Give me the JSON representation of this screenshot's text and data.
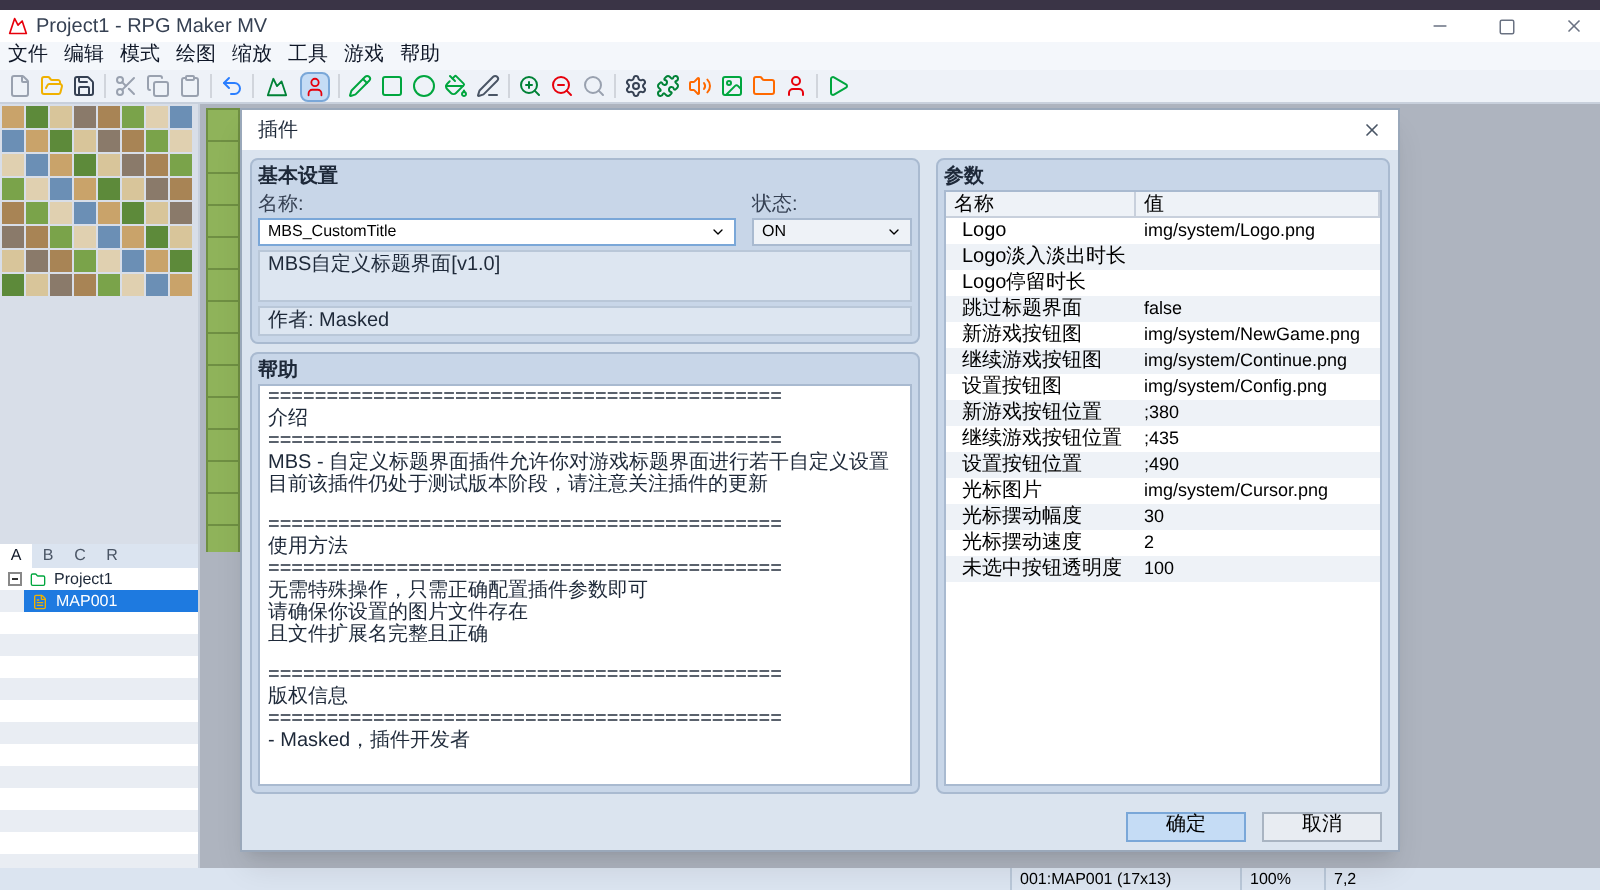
{
  "window": {
    "title": "Project1 - RPG Maker MV"
  },
  "menu": [
    "文件",
    "编辑",
    "模式",
    "绘图",
    "缩放",
    "工具",
    "游戏",
    "帮助"
  ],
  "toolbar": {
    "mode_buttons": [
      {
        "selected": false
      },
      {
        "selected": true
      }
    ]
  },
  "tileset_tabs": [
    {
      "label": "A",
      "selected": true
    },
    {
      "label": "B",
      "selected": false
    },
    {
      "label": "C",
      "selected": false
    },
    {
      "label": "R",
      "selected": false
    }
  ],
  "map_tree": [
    {
      "label": "Project1",
      "selected": false,
      "expanded": true,
      "children": [
        {
          "label": "MAP001",
          "selected": true
        }
      ]
    }
  ],
  "dialog": {
    "title": "插件",
    "basic": {
      "title": "基本设置",
      "name_label": "名称:",
      "name_value": "MBS_CustomTitle",
      "status_label": "状态:",
      "status_value": "ON",
      "description": "MBS自定义标题界面[v1.0]",
      "author": "作者: Masked"
    },
    "help": {
      "title": "帮助",
      "sections": [
        {
          "rule": "============================================",
          "heading": "介绍",
          "rule_after": "============================================",
          "body": [
            "MBS - 自定义标题界面插件允许你对游戏标题界面进行若干自定义设置",
            "目前该插件仍处于测试版本阶段，请注意关注插件的更新"
          ]
        },
        {
          "rule": "============================================",
          "heading": "使用方法",
          "rule_after": "============================================",
          "body": [
            "无需特殊操作，只需正确配置插件参数即可",
            "请确保你设置的图片文件存在",
            "且文件扩展名完整且正确"
          ]
        },
        {
          "rule": "============================================",
          "heading": "版权信息",
          "rule_after": "============================================",
          "body": [
            "- Masked，插件开发者"
          ]
        }
      ]
    },
    "params": {
      "title": "参数",
      "columns": [
        "名称",
        "值"
      ],
      "rows": [
        {
          "name": "Logo",
          "value": "img/system/Logo.png"
        },
        {
          "name": "Logo淡入淡出时长"
        },
        {
          "name": "Logo停留时长"
        },
        {
          "name": "跳过标题界面",
          "value": "false"
        },
        {
          "name": "新游戏按钮图",
          "value": "img/system/NewGame.png"
        },
        {
          "name": "继续游戏按钮图",
          "value": "img/system/Continue.png"
        },
        {
          "name": "设置按钮图",
          "value": "img/system/Config.png"
        },
        {
          "name": "新游戏按钮位置",
          "value": ";380"
        },
        {
          "name": "继续游戏按钮位置",
          "value": ";435"
        },
        {
          "name": "设置按钮位置",
          "value": ";490"
        },
        {
          "name": "光标图片",
          "value": "img/system/Cursor.png"
        },
        {
          "name": "光标摆动幅度",
          "value": "30"
        },
        {
          "name": "光标摆动速度",
          "value": "2"
        },
        {
          "name": "未选中按钮透明度",
          "value": "100"
        }
      ]
    },
    "buttons": [
      "确定",
      "取消"
    ]
  },
  "status_bar": [
    "001:MAP001 (17x13)",
    "100%",
    "7,2"
  ]
}
